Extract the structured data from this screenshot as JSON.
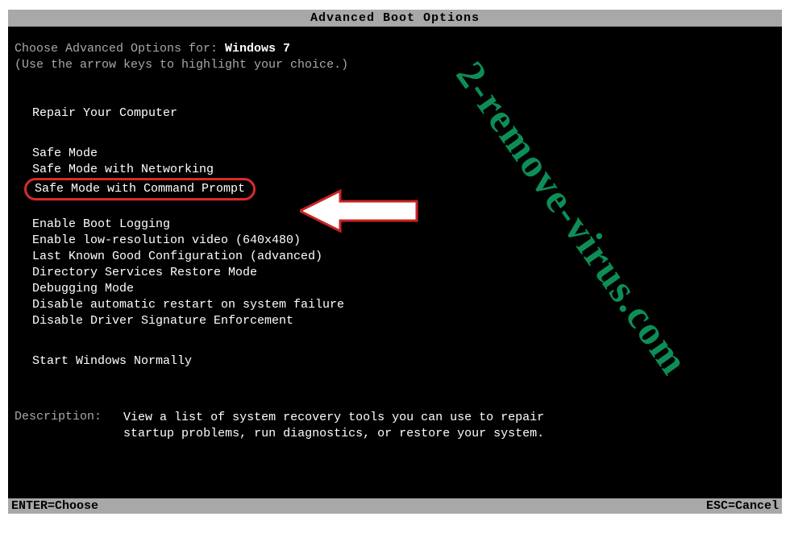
{
  "title": "Advanced Boot Options",
  "choose_prefix": "Choose Advanced Options for: ",
  "os_name": "Windows 7",
  "hint": "(Use the arrow keys to highlight your choice.)",
  "repair": "Repair Your Computer",
  "options": {
    "safe": "Safe Mode",
    "safe_net": "Safe Mode with Networking",
    "safe_cmd": "Safe Mode with Command Prompt",
    "boot_log": "Enable Boot Logging",
    "low_res": "Enable low-resolution video (640x480)",
    "lkgc": "Last Known Good Configuration (advanced)",
    "dsrm": "Directory Services Restore Mode",
    "debug": "Debugging Mode",
    "no_restart": "Disable automatic restart on system failure",
    "no_sig": "Disable Driver Signature Enforcement",
    "normal": "Start Windows Normally"
  },
  "description": {
    "label": "Description:",
    "text": "View a list of system recovery tools you can use to repair startup problems, run diagnostics, or restore your system."
  },
  "footer": {
    "enter": "ENTER=Choose",
    "esc": "ESC=Cancel"
  },
  "watermark": "2-remove-virus.com"
}
